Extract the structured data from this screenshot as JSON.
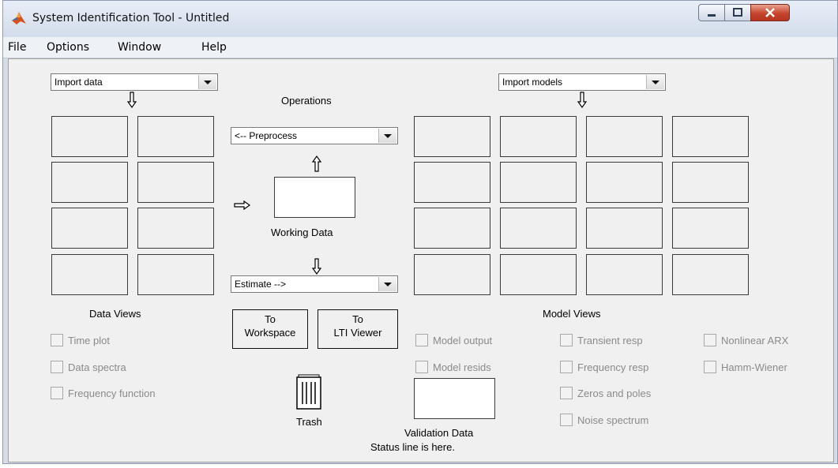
{
  "window": {
    "title": "System Identification Tool - Untitled"
  },
  "menu": {
    "items": [
      "File",
      "Options",
      "Window",
      "Help"
    ]
  },
  "data_panel": {
    "dropdown": "Import data",
    "caption": "Data Views"
  },
  "operations": {
    "heading": "Operations",
    "preprocess": "<-- Preprocess",
    "working_data": "Working Data",
    "estimate": "Estimate -->",
    "to_workspace": [
      "To",
      "Workspace"
    ],
    "to_lti": [
      "To",
      "LTI Viewer"
    ],
    "trash": "Trash"
  },
  "model_panel": {
    "dropdown": "Import models",
    "caption": "Model Views"
  },
  "data_views": {
    "options": [
      "Time plot",
      "Data spectra",
      "Frequency function"
    ]
  },
  "model_views": {
    "col1": [
      "Model output",
      "Model resids"
    ],
    "col2": [
      "Transient resp",
      "Frequency resp",
      "Zeros and poles",
      "Noise spectrum"
    ],
    "col3": [
      "Nonlinear ARX",
      "Hamm-Wiener"
    ]
  },
  "validation": {
    "label": "Validation Data"
  },
  "status": {
    "text": "Status line is here."
  },
  "colors": {
    "background": "#f0f0f0",
    "disabled_text": "#8a8a8a",
    "close_button": "#c6452e"
  }
}
